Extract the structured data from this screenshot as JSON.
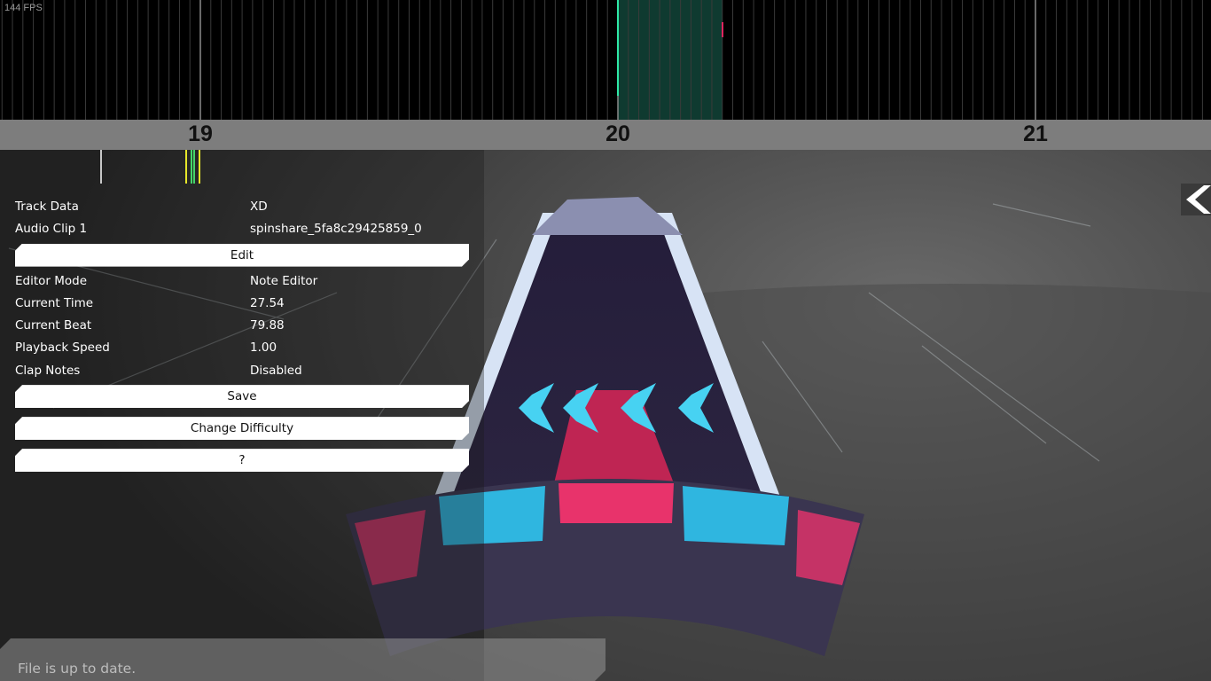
{
  "fps_label": "144 FPS",
  "timeline": {
    "beat_numbers": [
      "19",
      "20",
      "21"
    ]
  },
  "panel": {
    "rows_top": [
      {
        "label": "Track Data",
        "value": "XD"
      },
      {
        "label": "Audio Clip 1",
        "value": "spinshare_5fa8c29425859_0"
      }
    ],
    "edit_label": "Edit",
    "rows_bottom": [
      {
        "label": "Editor Mode",
        "value": "Note Editor"
      },
      {
        "label": "Current Time",
        "value": "27.54"
      },
      {
        "label": "Current Beat",
        "value": "79.88"
      },
      {
        "label": "Playback Speed",
        "value": "1.00"
      },
      {
        "label": "Clap Notes",
        "value": "Disabled"
      }
    ],
    "save_label": "Save",
    "change_difficulty_label": "Change Difficulty",
    "help_label": "?"
  },
  "status": {
    "message": "File is up to date."
  },
  "colors": {
    "accent_green": "#2ee8a6",
    "note_red": "#e0245e",
    "note_cyan": "#3ec8f0",
    "marker_yellow": "#e6e62a",
    "marker_green": "#45d66a"
  }
}
